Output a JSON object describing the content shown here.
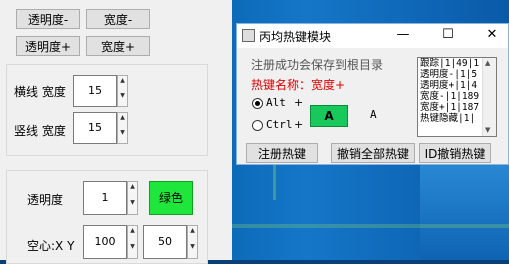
{
  "left_panel": {
    "buttons": {
      "opacity_minus": "透明度-",
      "width_minus": "宽度-",
      "opacity_plus": "透明度+",
      "width_plus": "宽度+"
    },
    "line_group": {
      "horizontal_label": "横线 宽度",
      "horizontal_value": "15",
      "vertical_label": "竖线 宽度",
      "vertical_value": "15"
    },
    "bottom_group": {
      "opacity_label": "透明度",
      "opacity_value": "1",
      "color_button": "绿色",
      "hollow_label": "空心:X Y",
      "x_value": "100",
      "y_value": "50"
    }
  },
  "dialog": {
    "title": "丙均热键模块",
    "controls": {
      "minimize": "—",
      "maximize": "☐",
      "close": "✕"
    },
    "info_text": "注册成功会保存到根目录",
    "hotkey_name": "热键名称：宽度+",
    "alt_label": "Alt",
    "ctrl_label": "Ctrl",
    "plus1": "+",
    "plus2": "+",
    "key_box": "A",
    "key_display": "A",
    "list_rows": [
      "跟踪|1|49|1",
      "透明度-|1|5",
      "透明度+|1|4",
      "宽度-|1|189",
      "宽度+|1|187",
      "热键隐藏|1|"
    ],
    "register_button": "注册热键",
    "unregister_all_button": "撤销全部热键",
    "unregister_id_button": "ID撤销热键"
  },
  "colors": {
    "accent_green": "#1ee63a",
    "dialog_key_green": "#16c95a",
    "hotkey_red": "#e00000"
  }
}
